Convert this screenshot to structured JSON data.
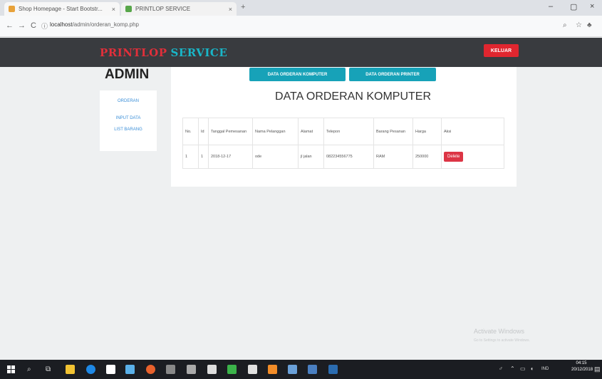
{
  "browser": {
    "tabs": [
      {
        "title": "Shop Homepage - Start Bootstr...",
        "close": "×"
      },
      {
        "title": "PRINTLOP SERVICE",
        "close": "×"
      }
    ],
    "new_tab": "+",
    "window_controls": {
      "minimize": "–",
      "maximize": "▢",
      "close": "×"
    },
    "nav": {
      "back": "←",
      "forward": "→",
      "reload": "C"
    },
    "url_host": "localhost",
    "url_path": "/admin/orderan_komp.php",
    "secure_icon": "ⓘ"
  },
  "app": {
    "brand_part1": "PRINTLOP",
    "brand_part2": "SERVICE",
    "logout_label": "KELUAR"
  },
  "sidebar": {
    "title": "ADMIN",
    "items": [
      {
        "label": "ORDERAN"
      },
      {
        "label": "INPUT DATA"
      },
      {
        "label": "LIST BARANG"
      }
    ]
  },
  "main": {
    "tab_buttons": [
      {
        "label": "DATA ORDERAN KOMPUTER"
      },
      {
        "label": "DATA ORDERAN PRINTER"
      }
    ],
    "title": "DATA ORDERAN KOMPUTER",
    "table": {
      "headers": [
        "No.",
        "Id",
        "Tanggal Pemesanan",
        "Nama Pelanggan",
        "Alamat",
        "Telepon",
        "Barang Pesanan",
        "Harga",
        "Aksi"
      ],
      "rows": [
        {
          "cells": [
            "1",
            "1",
            "2018-12-17",
            "ode",
            "jl jalan",
            "082234556775",
            "RAM",
            "250000"
          ],
          "action": "Delete"
        }
      ]
    }
  },
  "watermark": {
    "line1": "Activate Windows",
    "line2": "Go to Settings to activate Windows."
  },
  "taskbar": {
    "time": "04:15",
    "date": "20/12/2018",
    "lang": "IND"
  },
  "colors": {
    "navbar": "#393b3f",
    "brand_red": "#e12f3a",
    "brand_cyan": "#19b6c8",
    "danger": "#dc3545",
    "info": "#17a2b8",
    "link": "#3b8fd8"
  }
}
